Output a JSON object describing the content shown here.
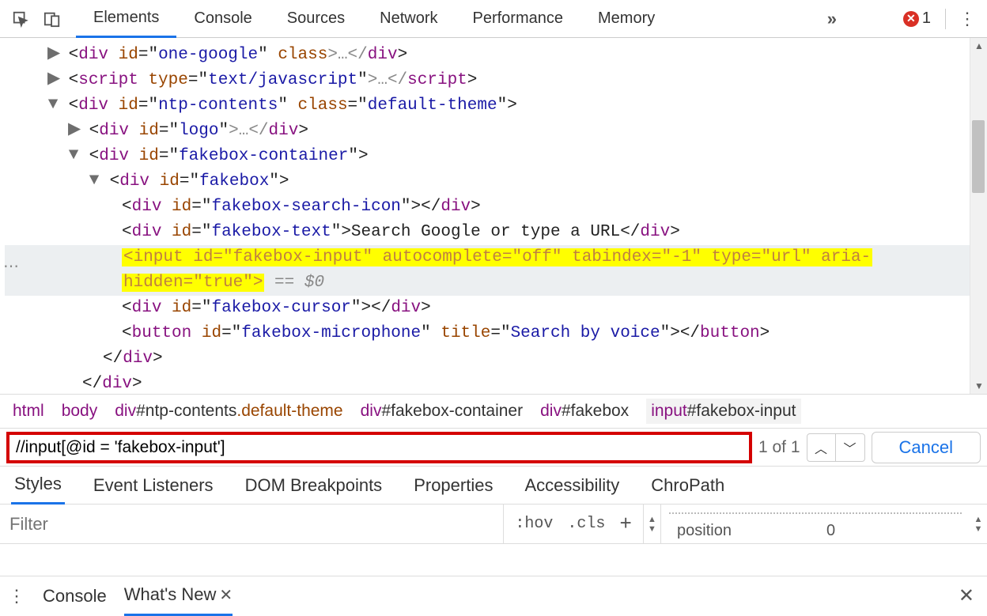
{
  "toolbar": {
    "tabs": [
      "Elements",
      "Console",
      "Sources",
      "Network",
      "Performance",
      "Memory"
    ],
    "error_count": "1"
  },
  "tree": {
    "l1": {
      "pre": "<",
      "tag": "div",
      "a1": "id",
      "v1": "one-google",
      "a2": "class",
      "post": ">…</",
      "tag2": "div",
      "end": ">"
    },
    "l2": {
      "pre": "<",
      "tag": "script",
      "a1": "type",
      "v1": "text/javascript",
      "post": ">…</",
      "tag2": "script",
      "end": ">"
    },
    "l3": {
      "pre": "<",
      "tag": "div",
      "a1": "id",
      "v1": "ntp-contents",
      "a2": "class",
      "v2": "default-theme",
      "post": ">"
    },
    "l4": {
      "pre": "<",
      "tag": "div",
      "a1": "id",
      "v1": "logo",
      "post": ">…</",
      "tag2": "div",
      "end": ">"
    },
    "l5": {
      "pre": "<",
      "tag": "div",
      "a1": "id",
      "v1": "fakebox-container",
      "post": ">"
    },
    "l6": {
      "pre": "<",
      "tag": "div",
      "a1": "id",
      "v1": "fakebox",
      "post": ">"
    },
    "l7": {
      "pre": "<",
      "tag": "div",
      "a1": "id",
      "v1": "fakebox-search-icon",
      "post": "></",
      "tag2": "div",
      "end": ">"
    },
    "l8": {
      "pre": "<",
      "tag": "div",
      "a1": "id",
      "v1": "fakebox-text",
      "post": ">",
      "text": "Search Google or type a URL",
      "close": "</",
      "tag2": "div",
      "end": ">"
    },
    "l9a": "<input id=\"fakebox-input\" autocomplete=\"off\" tabindex=\"-1\" type=\"url\" aria-",
    "l9b": "hidden=\"true\">",
    "l9_suffix": " == $0",
    "l10": {
      "pre": "<",
      "tag": "div",
      "a1": "id",
      "v1": "fakebox-cursor",
      "post": "></",
      "tag2": "div",
      "end": ">"
    },
    "l11": {
      "pre": "<",
      "tag": "button",
      "a1": "id",
      "v1": "fakebox-microphone",
      "a2": "title",
      "v2": "Search by voice",
      "post": "></",
      "tag2": "button",
      "end": ">"
    },
    "l12": {
      "pre": "</",
      "tag": "div",
      "post": ">"
    },
    "l13": {
      "pre": "</",
      "tag": "div",
      "post": ">"
    }
  },
  "crumbs": [
    {
      "tag": "html"
    },
    {
      "tag": "body"
    },
    {
      "tag": "div",
      "id": "#ntp-contents",
      "cls": ".default-theme"
    },
    {
      "tag": "div",
      "id": "#fakebox-container"
    },
    {
      "tag": "div",
      "id": "#fakebox"
    },
    {
      "tag": "input",
      "id": "#fakebox-input",
      "sel": true
    }
  ],
  "search": {
    "value": "//input[@id = 'fakebox-input']",
    "match": "1 of 1",
    "cancel": "Cancel"
  },
  "styles_tabs": [
    "Styles",
    "Event Listeners",
    "DOM Breakpoints",
    "Properties",
    "Accessibility",
    "ChroPath"
  ],
  "filter": {
    "placeholder": "Filter",
    "hov": ":hov",
    "cls": ".cls",
    "prop_key": "position",
    "prop_val": "0"
  },
  "drawer": {
    "tabs": [
      "Console",
      "What's New"
    ]
  }
}
